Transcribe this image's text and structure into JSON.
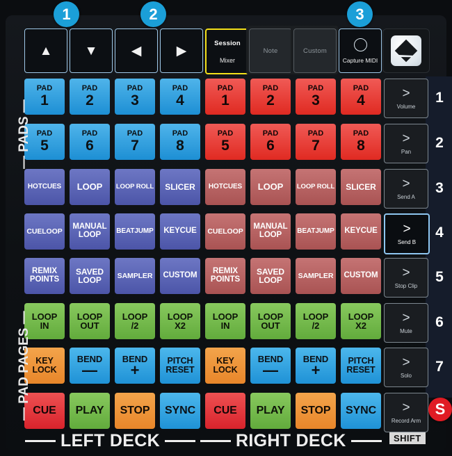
{
  "device": {
    "name": "Novation Launchpad DJ pad map overlay",
    "logo_icon": "novation-logo-icon"
  },
  "callouts": [
    {
      "id": "1",
      "label": "1"
    },
    {
      "id": "2",
      "label": "2"
    },
    {
      "id": "3",
      "label": "3"
    },
    {
      "id": "S",
      "label": "S"
    }
  ],
  "top_buttons": [
    {
      "name": "up-arrow",
      "glyph": "▲",
      "style": "outline"
    },
    {
      "name": "down-arrow",
      "glyph": "▼",
      "style": "outline"
    },
    {
      "name": "left-arrow",
      "glyph": "◀",
      "style": "outline"
    },
    {
      "name": "right-arrow",
      "glyph": "▶",
      "style": "outline"
    },
    {
      "name": "session-mixer",
      "line1": "Session",
      "line2": "Mixer",
      "style": "selected"
    },
    {
      "name": "note",
      "line1": "Note",
      "style": "dim"
    },
    {
      "name": "custom",
      "line1": "Custom",
      "style": "dim"
    },
    {
      "name": "capture-midi",
      "line1": "Capture MIDI",
      "style": "circle"
    }
  ],
  "side_labels": {
    "pads": "— PADS —",
    "pad_pages": "— PAD PAGES —"
  },
  "deck_labels": {
    "left": "LEFT DECK",
    "right": "RIGHT DECK"
  },
  "shift_label": "SHIFT",
  "scene_buttons": [
    {
      "row": "1",
      "label": "Volume",
      "active": false
    },
    {
      "row": "2",
      "label": "Pan",
      "active": false
    },
    {
      "row": "3",
      "label": "Send A",
      "active": false
    },
    {
      "row": "4",
      "label": "Send B",
      "active": true
    },
    {
      "row": "5",
      "label": "Stop Clip",
      "active": false
    },
    {
      "row": "6",
      "label": "Mute",
      "active": false
    },
    {
      "row": "7",
      "label": "Solo",
      "active": false
    },
    {
      "row": "S",
      "label": "Record Arm",
      "active": false
    }
  ],
  "colors": {
    "badge_blue": "#1b9fd8",
    "badge_red": "#e01b24",
    "selected_yellow": "#f4e019",
    "pad_blue": "#2d9ad8",
    "pad_red": "#e43a33",
    "pad_purple": "#5a63b4",
    "pad_maroon": "#b36161",
    "pad_green": "#72b849",
    "pad_orange": "#ed9036",
    "navy_strip": "#151c2b"
  },
  "pad_grid": {
    "rows": [
      {
        "row": 1,
        "left": [
          {
            "t1": "PAD",
            "t2": "1",
            "color": "p-blue"
          },
          {
            "t1": "PAD",
            "t2": "2",
            "color": "p-blue"
          },
          {
            "t1": "PAD",
            "t2": "3",
            "color": "p-blue"
          },
          {
            "t1": "PAD",
            "t2": "4",
            "color": "p-blue"
          }
        ],
        "right": [
          {
            "t1": "PAD",
            "t2": "1",
            "color": "p-red"
          },
          {
            "t1": "PAD",
            "t2": "2",
            "color": "p-red"
          },
          {
            "t1": "PAD",
            "t2": "3",
            "color": "p-red"
          },
          {
            "t1": "PAD",
            "t2": "4",
            "color": "p-red"
          }
        ]
      },
      {
        "row": 2,
        "left": [
          {
            "t1": "PAD",
            "t2": "5",
            "color": "p-blue"
          },
          {
            "t1": "PAD",
            "t2": "6",
            "color": "p-blue"
          },
          {
            "t1": "PAD",
            "t2": "7",
            "color": "p-blue"
          },
          {
            "t1": "PAD",
            "t2": "8",
            "color": "p-blue"
          }
        ],
        "right": [
          {
            "t1": "PAD",
            "t2": "5",
            "color": "p-red"
          },
          {
            "t1": "PAD",
            "t2": "6",
            "color": "p-red"
          },
          {
            "t1": "PAD",
            "t2": "7",
            "color": "p-red"
          },
          {
            "t1": "PAD",
            "t2": "8",
            "color": "p-red"
          }
        ]
      },
      {
        "row": 3,
        "left": [
          {
            "lbl": "HOTCUES",
            "size": 10,
            "color": "p-purple"
          },
          {
            "lbl": "LOOP",
            "size": 13,
            "color": "p-purple"
          },
          {
            "lbl": "LOOP ROLL",
            "size": 9.5,
            "color": "p-purple"
          },
          {
            "lbl": "SLICER",
            "size": 12,
            "color": "p-purple"
          }
        ],
        "right": [
          {
            "lbl": "HOTCUES",
            "size": 10,
            "color": "p-maroon"
          },
          {
            "lbl": "LOOP",
            "size": 13,
            "color": "p-maroon"
          },
          {
            "lbl": "LOOP ROLL",
            "size": 9.5,
            "color": "p-maroon"
          },
          {
            "lbl": "SLICER",
            "size": 12,
            "color": "p-maroon"
          }
        ]
      },
      {
        "row": 4,
        "left": [
          {
            "lbl": "CUELOOP",
            "size": 10.5,
            "color": "p-purple"
          },
          {
            "lbl": "MANUAL\nLOOP",
            "size": 11.5,
            "color": "p-purple"
          },
          {
            "lbl": "BEATJUMP",
            "size": 10,
            "color": "p-purple"
          },
          {
            "lbl": "KEYCUE",
            "size": 11.5,
            "color": "p-purple"
          }
        ],
        "right": [
          {
            "lbl": "CUELOOP",
            "size": 10.5,
            "color": "p-maroon"
          },
          {
            "lbl": "MANUAL\nLOOP",
            "size": 11.5,
            "color": "p-maroon"
          },
          {
            "lbl": "BEATJUMP",
            "size": 10,
            "color": "p-maroon"
          },
          {
            "lbl": "KEYCUE",
            "size": 11.5,
            "color": "p-maroon"
          }
        ]
      },
      {
        "row": 5,
        "left": [
          {
            "lbl": "REMIX\nPOINTS",
            "size": 11.5,
            "color": "p-purple"
          },
          {
            "lbl": "SAVED\nLOOP",
            "size": 12,
            "color": "p-purple"
          },
          {
            "lbl": "SAMPLER",
            "size": 10.5,
            "color": "p-purple"
          },
          {
            "lbl": "CUSTOM",
            "size": 11.5,
            "color": "p-purple"
          }
        ],
        "right": [
          {
            "lbl": "REMIX\nPOINTS",
            "size": 11.5,
            "color": "p-maroon"
          },
          {
            "lbl": "SAVED\nLOOP",
            "size": 12,
            "color": "p-maroon"
          },
          {
            "lbl": "SAMPLER",
            "size": 10.5,
            "color": "p-maroon"
          },
          {
            "lbl": "CUSTOM",
            "size": 11.5,
            "color": "p-maroon"
          }
        ]
      },
      {
        "row": 6,
        "left": [
          {
            "lbl": "LOOP\nIN",
            "size": 13,
            "color": "p-green"
          },
          {
            "lbl": "LOOP\nOUT",
            "size": 13,
            "color": "p-green"
          },
          {
            "lbl": "LOOP\n/2",
            "size": 13,
            "color": "p-green"
          },
          {
            "lbl": "LOOP\nX2",
            "size": 13,
            "color": "p-green"
          }
        ],
        "right": [
          {
            "lbl": "LOOP\nIN",
            "size": 13,
            "color": "p-green"
          },
          {
            "lbl": "LOOP\nOUT",
            "size": 13,
            "color": "p-green"
          },
          {
            "lbl": "LOOP\n/2",
            "size": 13,
            "color": "p-green"
          },
          {
            "lbl": "LOOP\nX2",
            "size": 13,
            "color": "p-green"
          }
        ]
      },
      {
        "row": 7,
        "left": [
          {
            "lbl": "KEY\nLOCK",
            "size": 12.5,
            "color": "p-orange"
          },
          {
            "lbl": "BEND",
            "size": 13,
            "sym": "—",
            "color": "p-cyan"
          },
          {
            "lbl": "BEND",
            "size": 13,
            "sym": "+",
            "color": "p-cyan"
          },
          {
            "lbl": "PITCH\nRESET",
            "size": 12.5,
            "color": "p-cyan"
          }
        ],
        "right": [
          {
            "lbl": "KEY\nLOCK",
            "size": 12.5,
            "color": "p-orange"
          },
          {
            "lbl": "BEND",
            "size": 13,
            "sym": "—",
            "color": "p-cyan"
          },
          {
            "lbl": "BEND",
            "size": 13,
            "sym": "+",
            "color": "p-cyan"
          },
          {
            "lbl": "PITCH\nRESET",
            "size": 12.5,
            "color": "p-cyan"
          }
        ]
      },
      {
        "row": 8,
        "left": [
          {
            "lbl": "CUE",
            "size": 16,
            "color": "p-crimson"
          },
          {
            "lbl": "PLAY",
            "size": 16,
            "color": "p-green"
          },
          {
            "lbl": "STOP",
            "size": 16,
            "color": "p-orange"
          },
          {
            "lbl": "SYNC",
            "size": 16,
            "color": "p-cyan"
          }
        ],
        "right": [
          {
            "lbl": "CUE",
            "size": 16,
            "color": "p-crimson"
          },
          {
            "lbl": "PLAY",
            "size": 16,
            "color": "p-green"
          },
          {
            "lbl": "STOP",
            "size": 16,
            "color": "p-orange"
          },
          {
            "lbl": "SYNC",
            "size": 16,
            "color": "p-cyan"
          }
        ]
      }
    ]
  }
}
